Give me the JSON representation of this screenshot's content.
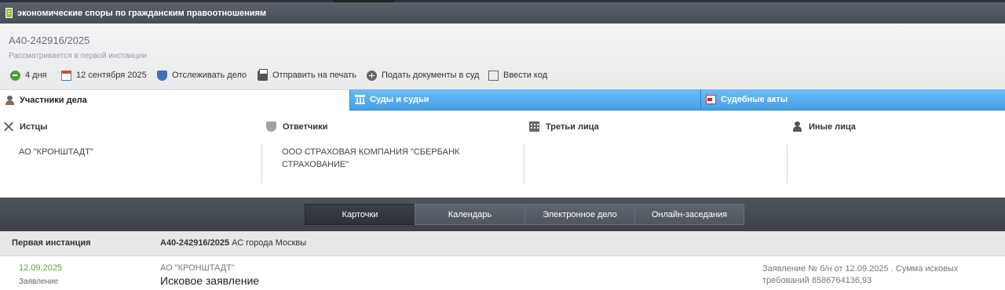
{
  "window": {
    "title": "экономические споры по гражданским правоотношениям"
  },
  "case": {
    "number": "А40-242916/2025",
    "status": "Рассматривается в первой инстанции"
  },
  "toolbar": {
    "duration": "4 дня",
    "date": "12 сентября 2025",
    "track": "Отслеживать дело",
    "print": "Отправить на печать",
    "submit": "Подать документы в суд",
    "code": "Ввести код"
  },
  "tabs": {
    "participants": "Участники дела",
    "courts": "Суды и судьи",
    "acts": "Судебные акты"
  },
  "participants": {
    "plaintiffs": {
      "label": "Истцы",
      "value": "АО \"КРОНШТАДТ\""
    },
    "defendants": {
      "label": "Ответчики",
      "value": "ООО СТРАХОВАЯ КОМПАНИЯ \"СБЕРБАНК СТРАХОВАНИЕ\""
    },
    "third": {
      "label": "Третьи лица",
      "value": ""
    },
    "others": {
      "label": "Иные лица",
      "value": ""
    }
  },
  "nav": {
    "cards": "Карточки",
    "calendar": "Календарь",
    "ecase": "Электронное дело",
    "online": "Онлайн-заседания"
  },
  "instance": {
    "label": "Первая инстанция",
    "case_number": "А40-242916/2025",
    "court": "АС города Москвы"
  },
  "entry": {
    "date": "12.09.2025",
    "kind": "Заявление",
    "who": "АО \"КРОНШТАДТ\"",
    "doc": "Исковое заявление",
    "desc": "Заявление № б/н от 12.09.2025 . Сумма исковых требований 8586764136,93"
  },
  "colors": {
    "tab_blue": "#45a2e6",
    "dark_band": "#474d56",
    "date_green": "#5aa33a"
  }
}
